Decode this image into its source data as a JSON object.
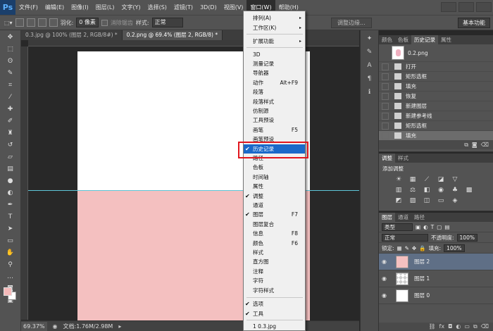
{
  "app": {
    "logo": "Ps"
  },
  "menubar": {
    "items": [
      "文件(F)",
      "编辑(E)",
      "图像(I)",
      "图层(L)",
      "文字(Y)",
      "选择(S)",
      "滤镜(T)",
      "3D(D)",
      "视图(V)",
      "窗口(W)",
      "帮助(H)"
    ],
    "active_index": 9
  },
  "options": {
    "feather_label": "羽化:",
    "feather_value": "0 像素",
    "antialias_label": "消除锯齿",
    "style_label": "样式:",
    "style_value": "正常",
    "width_label": "宽度",
    "refine_edge": "调整边缘...",
    "workspace": "基本功能"
  },
  "tabs": [
    {
      "label": "0.3.jpg @ 100% (图层 2, RGB/8#) *"
    },
    {
      "label": "0.2.png @ 69.4% (图层 2, RGB/8) *"
    }
  ],
  "status": {
    "zoom": "69.37%",
    "doc": "文档:1.76M/2.98M"
  },
  "window_menu": {
    "top": [
      {
        "label": "排列(A)",
        "arrow": "▸"
      },
      {
        "label": "工作区(K)",
        "arrow": "▸"
      }
    ],
    "ext": [
      {
        "label": "扩展功能",
        "arrow": "▸"
      }
    ],
    "panels": [
      {
        "label": "3D"
      },
      {
        "label": "测量记录"
      },
      {
        "label": "导航器"
      },
      {
        "label": "动作",
        "shortcut": "Alt+F9"
      },
      {
        "label": "段落"
      },
      {
        "label": "段落样式"
      },
      {
        "label": "仿制源"
      },
      {
        "label": "工具预设"
      },
      {
        "label": "画笔",
        "shortcut": "F5"
      },
      {
        "label": "画笔预设"
      },
      {
        "label": "历史记录",
        "check": "✔"
      },
      {
        "label": "路径"
      },
      {
        "label": "色板"
      },
      {
        "label": "时间轴"
      },
      {
        "label": "属性"
      },
      {
        "label": "调整",
        "check": "✔"
      },
      {
        "label": "通道"
      },
      {
        "label": "图层",
        "check": "✔",
        "shortcut": "F7"
      },
      {
        "label": "图层复合"
      },
      {
        "label": "信息",
        "shortcut": "F8"
      },
      {
        "label": "颜色",
        "shortcut": "F6"
      },
      {
        "label": "样式"
      },
      {
        "label": "直方图"
      },
      {
        "label": "注释"
      },
      {
        "label": "字符"
      },
      {
        "label": "字符样式"
      }
    ],
    "bottom": [
      {
        "label": "选项",
        "check": "✔"
      },
      {
        "label": "工具",
        "check": "✔"
      }
    ],
    "files": [
      {
        "label": "1 0.3.jpg"
      }
    ]
  },
  "history_panel": {
    "tabs": [
      "颜色",
      "色板",
      "历史记录",
      "属性"
    ],
    "active_tab": 2,
    "snapshot": "0.2.png",
    "items": [
      "打开",
      "矩形选框",
      "填充",
      "恢复",
      "新建图层",
      "新建参考线",
      "矩形选框",
      "填充"
    ]
  },
  "adjust_panel": {
    "tabs": [
      "调整",
      "样式"
    ],
    "add_label": "添加调整"
  },
  "layers_panel": {
    "tabs": [
      "图层",
      "通道",
      "路径"
    ],
    "filter": "类型",
    "blend": "正常",
    "opacity_label": "不透明度:",
    "opacity": "100%",
    "lock_label": "锁定:",
    "fill_label": "填充:",
    "fill": "100%",
    "layers": [
      {
        "name": "图层 2",
        "selected": true
      },
      {
        "name": "图层 1",
        "selected": false
      },
      {
        "name": "图层 0",
        "selected": false
      }
    ]
  },
  "colors": {
    "foreground": "#f4b9b9",
    "highlight": "#1a69c9",
    "callout": "#e1161d",
    "guide": "#5ec6d8"
  }
}
